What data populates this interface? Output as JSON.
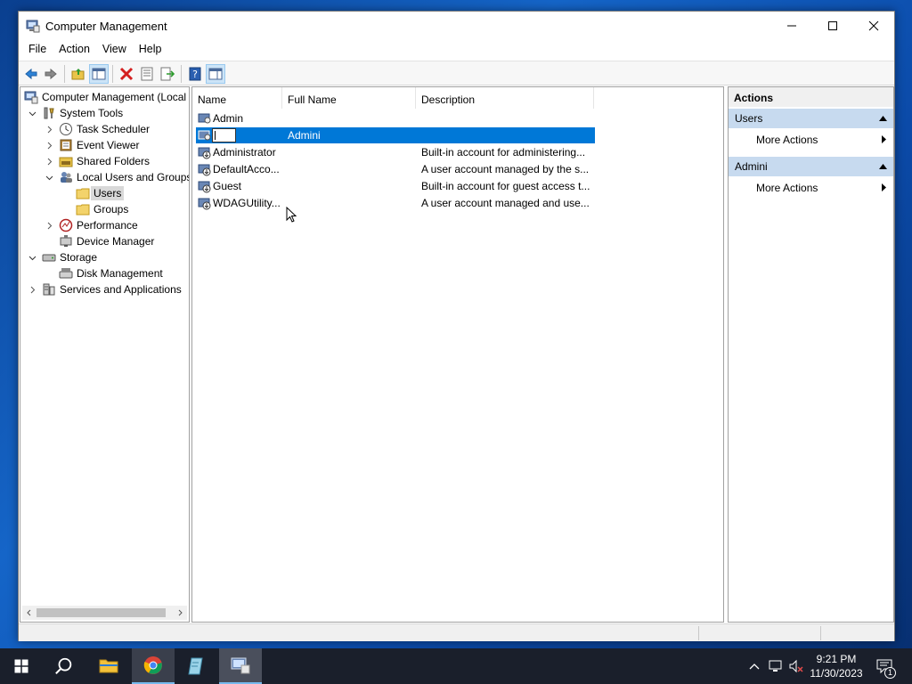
{
  "window": {
    "title": "Computer Management",
    "menu": [
      "File",
      "Action",
      "View",
      "Help"
    ]
  },
  "tree": {
    "items": [
      {
        "label": "Computer Management (Local",
        "icon": "computer-management-icon"
      },
      {
        "label": "System Tools",
        "icon": "system-tools-icon"
      },
      {
        "label": "Task Scheduler",
        "icon": "task-scheduler-icon"
      },
      {
        "label": "Event Viewer",
        "icon": "event-viewer-icon"
      },
      {
        "label": "Shared Folders",
        "icon": "shared-folders-icon"
      },
      {
        "label": "Local Users and Groups",
        "icon": "local-users-icon"
      },
      {
        "label": "Users",
        "icon": "folder-icon"
      },
      {
        "label": "Groups",
        "icon": "folder-icon"
      },
      {
        "label": "Performance",
        "icon": "performance-icon"
      },
      {
        "label": "Device Manager",
        "icon": "device-manager-icon"
      },
      {
        "label": "Storage",
        "icon": "storage-icon"
      },
      {
        "label": "Disk Management",
        "icon": "disk-management-icon"
      },
      {
        "label": "Services and Applications",
        "icon": "services-icon"
      }
    ]
  },
  "list": {
    "columns": [
      "Name",
      "Full Name",
      "Description"
    ],
    "rows": [
      {
        "name": "Admin",
        "full_name": "",
        "description": ""
      },
      {
        "name": "",
        "full_name": "Admini",
        "description": "",
        "editing": true
      },
      {
        "name": "Administrator",
        "full_name": "",
        "description": "Built-in account for administering..."
      },
      {
        "name": "DefaultAcco...",
        "full_name": "",
        "description": "A user account managed by the s..."
      },
      {
        "name": "Guest",
        "full_name": "",
        "description": "Built-in account for guest access t..."
      },
      {
        "name": "WDAGUtility...",
        "full_name": "",
        "description": "A user account managed and use..."
      }
    ]
  },
  "actions": {
    "header": "Actions",
    "sections": [
      {
        "title": "Users",
        "item": "More Actions"
      },
      {
        "title": "Admini",
        "item": "More Actions"
      }
    ]
  },
  "taskbar": {
    "time": "9:21 PM",
    "date": "11/30/2023",
    "notification_count": "1"
  },
  "colors": {
    "selection": "#0078d7",
    "section_header": "#c7daef",
    "taskbar": "#1a1f2b"
  }
}
